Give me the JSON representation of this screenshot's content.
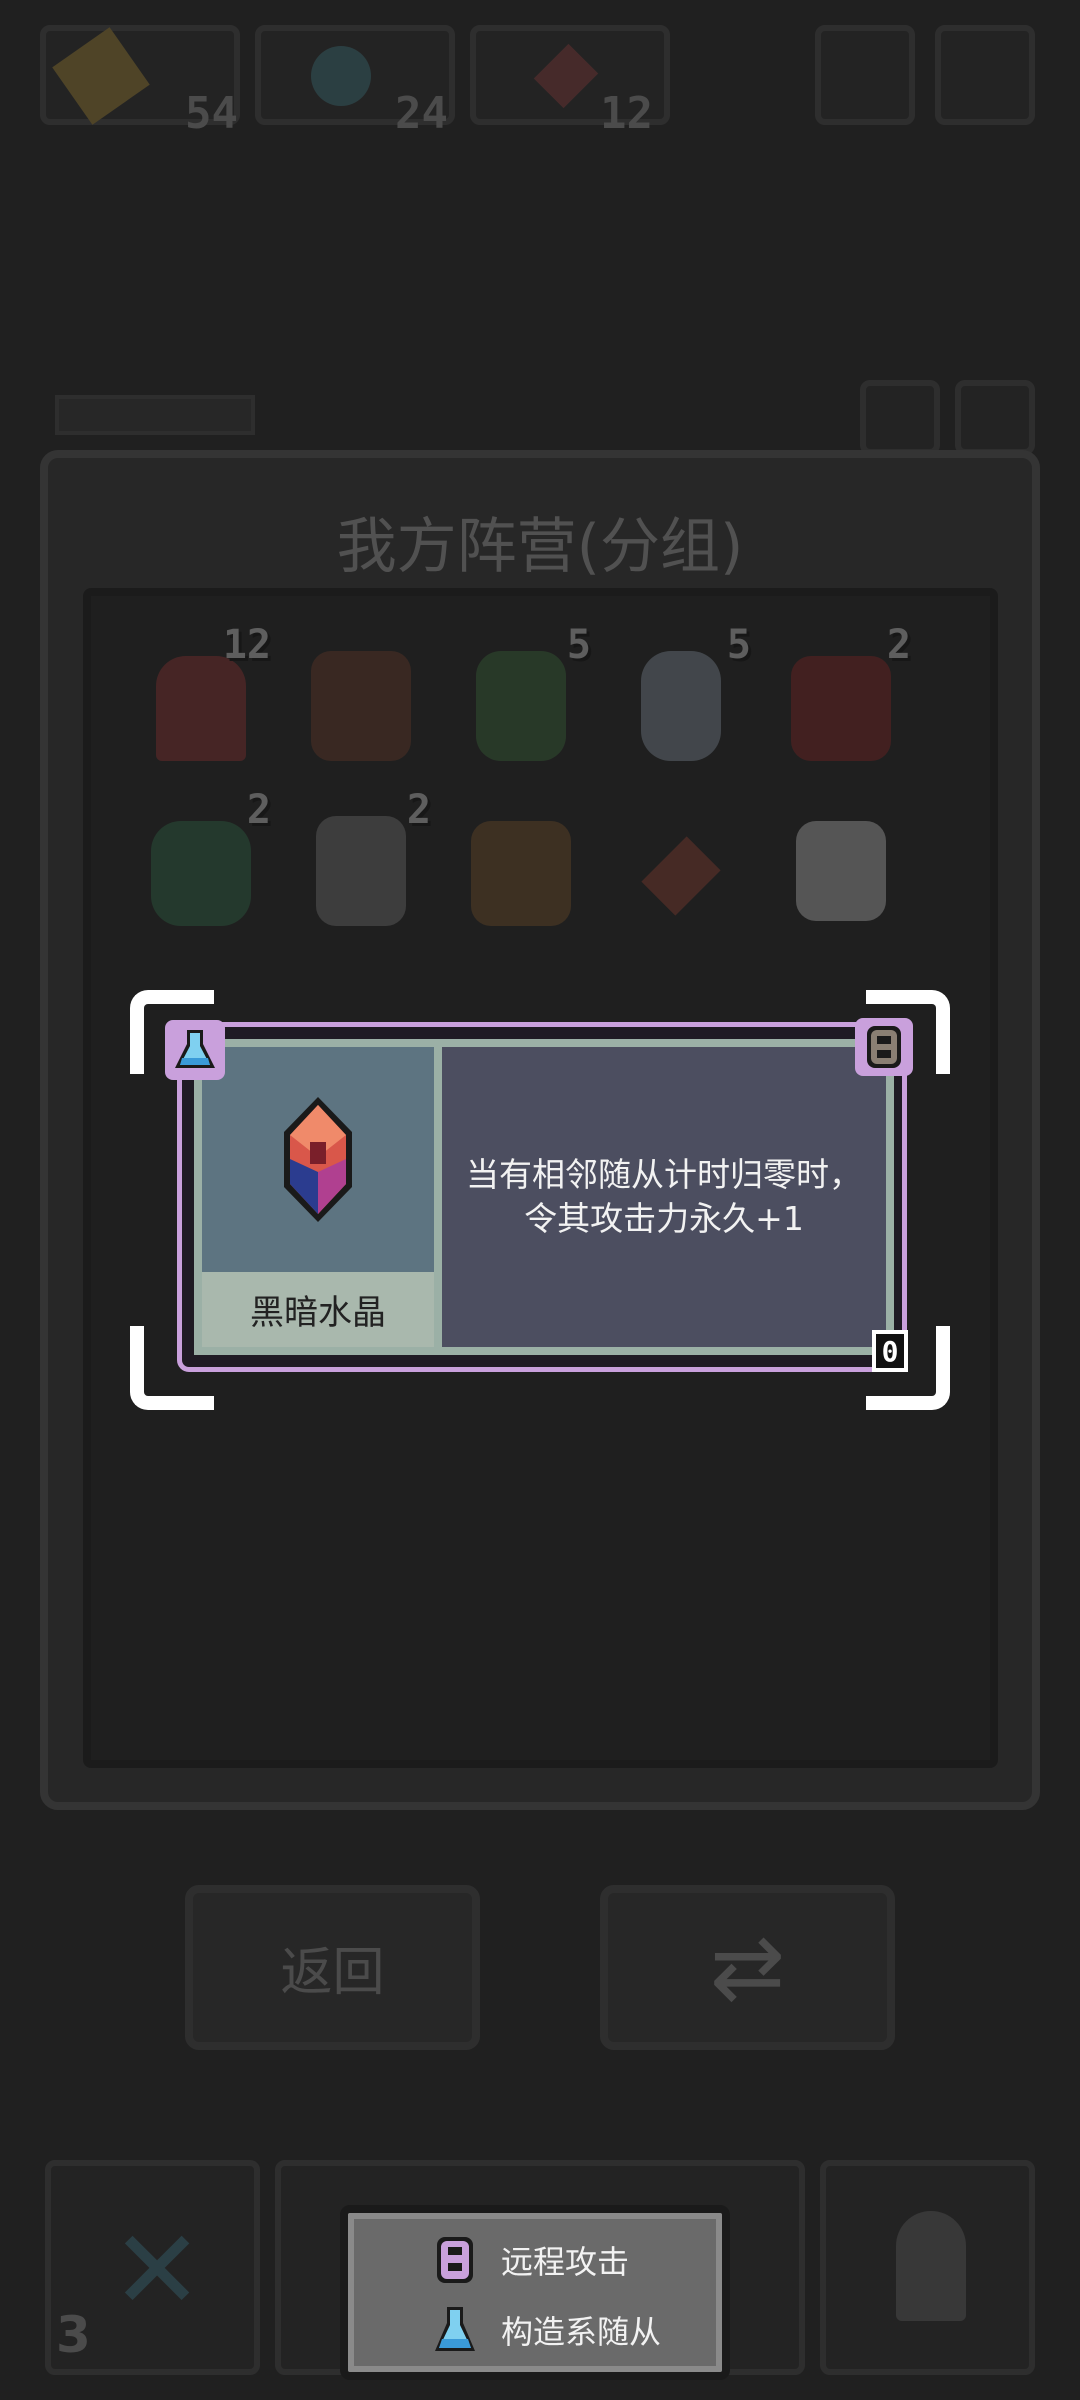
{
  "top_bar": {
    "stats": [
      {
        "icon": "hammer-icon",
        "value": "54"
      },
      {
        "icon": "potion-icon",
        "value": "24"
      },
      {
        "icon": "crystal-icon",
        "value": "12"
      }
    ]
  },
  "background_panel": {
    "title": "我方阵营(分组)",
    "units": [
      {
        "icon": "girl-unit-icon",
        "badge": "12",
        "color": "#a33"
      },
      {
        "icon": "demon-lord-icon",
        "badge": "",
        "color": "#7a3f2a"
      },
      {
        "icon": "goblin-icon",
        "badge": "5",
        "color": "#3f7a3f"
      },
      {
        "icon": "skeleton-icon",
        "badge": "5",
        "color": "#9ab"
      },
      {
        "icon": "red-demon-icon",
        "badge": "2",
        "color": "#922"
      },
      {
        "icon": "coil-snake-icon",
        "badge": "2",
        "color": "#2f7a4f"
      },
      {
        "icon": "werewolf-icon",
        "badge": "2",
        "color": "#888"
      },
      {
        "icon": "orc-warrior-icon",
        "badge": "",
        "color": "#8a5a2a"
      },
      {
        "icon": "dark-crystal-icon",
        "badge": "",
        "color": "#a43"
      },
      {
        "icon": "ghost-cat-icon",
        "badge": "",
        "color": "#ddd"
      }
    ],
    "back_label": "返回",
    "swap_icon": "swap-icon"
  },
  "card": {
    "name": "黑暗水晶",
    "description_line1": "当有相邻随从计时归零时，",
    "description_line2": "令其攻击力永久+1",
    "cost": "0",
    "left_tag_icon": "flask-icon",
    "right_tag_icon": "ranged-lock-icon",
    "frame_color": "#c9a0dc"
  },
  "legend": {
    "items": [
      {
        "icon": "ranged-lock-icon",
        "label": "远程攻击"
      },
      {
        "icon": "flask-icon",
        "label": "构造系随从"
      }
    ]
  },
  "bottom_nav": {
    "left_count": "3"
  }
}
